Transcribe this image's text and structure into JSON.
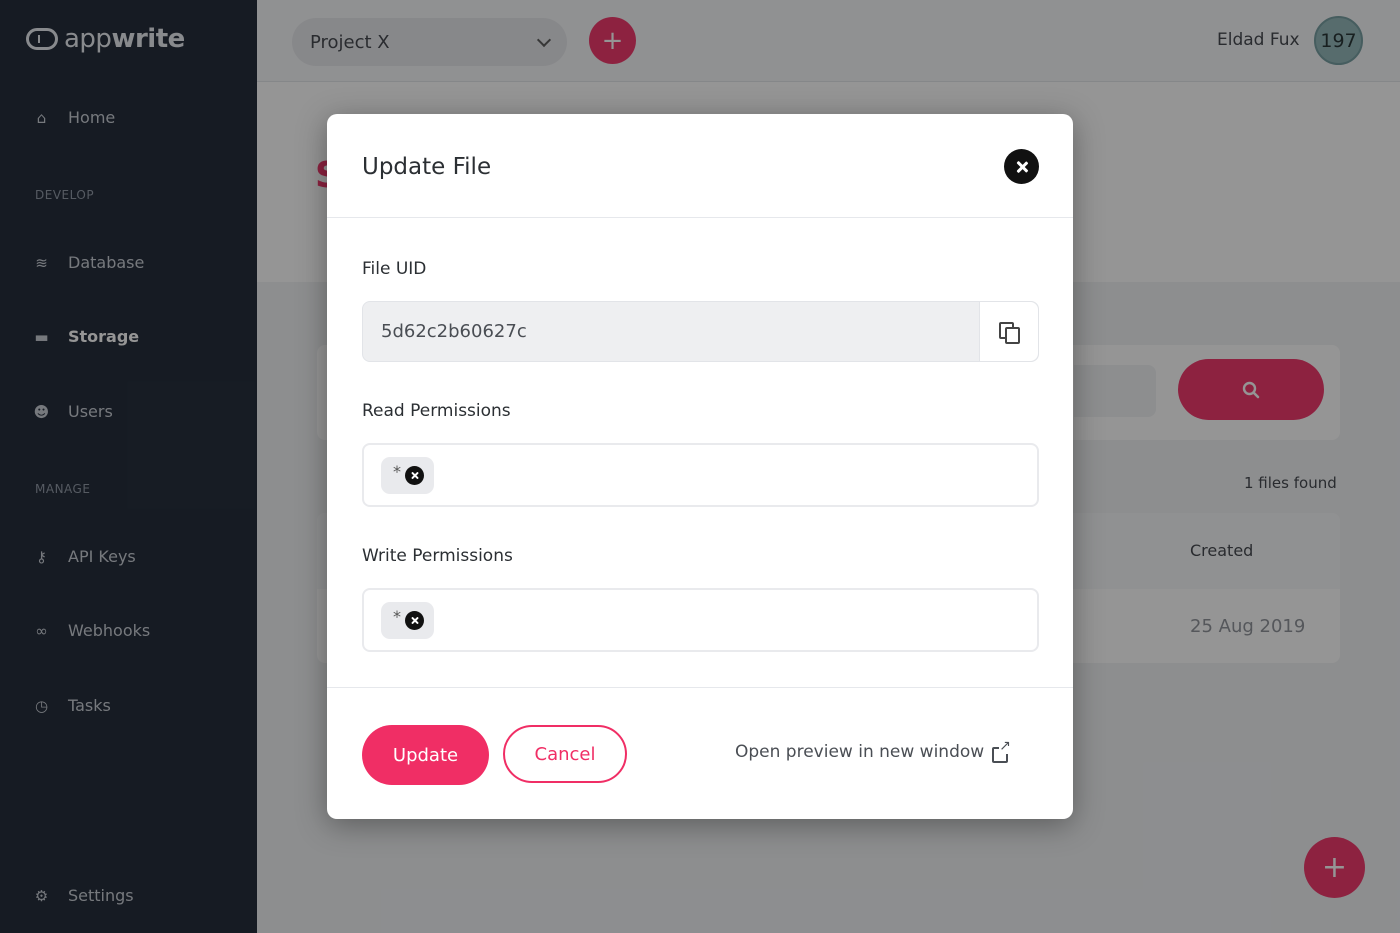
{
  "app": {
    "logo_text_light": "app",
    "logo_text_bold": "write"
  },
  "sidebar": {
    "items": [
      {
        "label": "Home",
        "icon": "home-icon"
      },
      {
        "label": "Database",
        "icon": "database-icon"
      },
      {
        "label": "Storage",
        "icon": "folder-icon"
      },
      {
        "label": "Users",
        "icon": "users-icon"
      },
      {
        "label": "API Keys",
        "icon": "key-icon"
      },
      {
        "label": "Webhooks",
        "icon": "webhook-icon"
      },
      {
        "label": "Tasks",
        "icon": "clock-icon"
      },
      {
        "label": "Settings",
        "icon": "gear-icon"
      }
    ],
    "sections": {
      "develop": "DEVELOP",
      "manage": "MANAGE"
    },
    "active": "Storage"
  },
  "header": {
    "project": "Project X",
    "add_symbol": "+",
    "user_name": "Eldad Fux",
    "avatar_text": "197"
  },
  "background": {
    "page_title_fragment": "S",
    "files_found": "1 files found",
    "table_header_created": "Created",
    "row_created": "25 Aug 2019",
    "fab_symbol": "+"
  },
  "modal": {
    "title": "Update File",
    "file_uid_label": "File UID",
    "file_uid_value": "5d62c2b60627c",
    "read_label": "Read Permissions",
    "read_tags": [
      "*"
    ],
    "write_label": "Write Permissions",
    "write_tags": [
      "*"
    ],
    "update_label": "Update",
    "cancel_label": "Cancel",
    "preview_link": "Open preview in new window"
  },
  "colors": {
    "accent": "#f02e65",
    "sidebar_bg": "#192231",
    "overlay": "rgba(20,20,20,0.45)"
  }
}
